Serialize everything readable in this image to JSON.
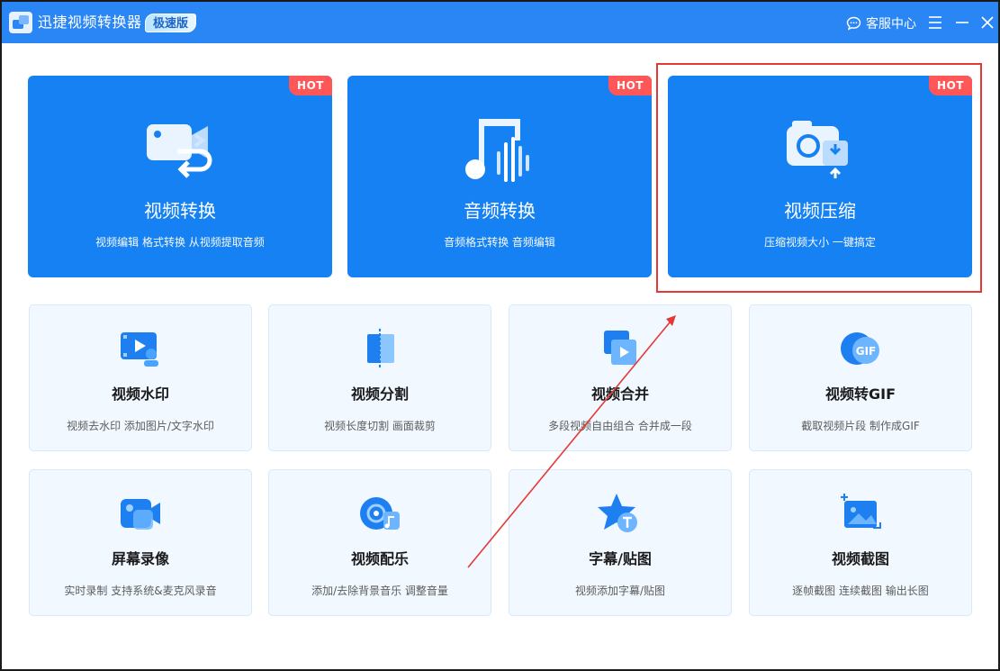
{
  "window": {
    "title": "迅捷视频转换器",
    "badge": "极速版",
    "support_label": "客服中心"
  },
  "featured": [
    {
      "title": "视频转换",
      "subtitle": "视频编辑 格式转换 从视频提取音频",
      "hot": "HOT",
      "icon": "video-convert-icon"
    },
    {
      "title": "音频转换",
      "subtitle": "音频格式转换 音频编辑",
      "hot": "HOT",
      "icon": "audio-convert-icon"
    },
    {
      "title": "视频压缩",
      "subtitle": "压缩视频大小 一键搞定",
      "hot": "HOT",
      "icon": "video-compress-icon"
    }
  ],
  "tools": [
    {
      "title": "视频水印",
      "subtitle": "视频去水印 添加图片/文字水印",
      "icon": "watermark-icon"
    },
    {
      "title": "视频分割",
      "subtitle": "视频长度切割 画面裁剪",
      "icon": "split-icon"
    },
    {
      "title": "视频合并",
      "subtitle": "多段视频自由组合 合并成一段",
      "icon": "merge-icon"
    },
    {
      "title": "视频转GIF",
      "subtitle": "截取视频片段 制作成GIF",
      "icon": "gif-icon"
    },
    {
      "title": "屏幕录像",
      "subtitle": "实时录制 支持系统&麦克风录音",
      "icon": "screen-record-icon"
    },
    {
      "title": "视频配乐",
      "subtitle": "添加/去除背景音乐 调整音量",
      "icon": "music-icon"
    },
    {
      "title": "字幕/贴图",
      "subtitle": "视频添加字幕/贴图",
      "icon": "subtitle-icon"
    },
    {
      "title": "视频截图",
      "subtitle": "逐帧截图 连续截图 输出长图",
      "icon": "screenshot-icon"
    }
  ],
  "colors": {
    "titlebar": "#2a86f4",
    "featured_card": "#1581f3",
    "hot_badge": "#ff5658",
    "tool_card": "#f1f8ff",
    "annotation": "#e53935"
  }
}
